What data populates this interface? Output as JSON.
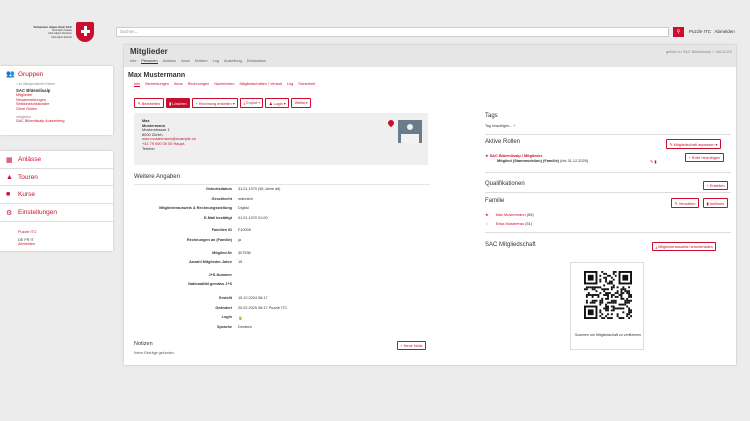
{
  "logo": {
    "lines": [
      "Schweizer Alpen-Club SAC",
      "Club Alpin Suisse",
      "Club Alpino Svizzero",
      "Club Alpin Svizzer"
    ]
  },
  "sidebar": {
    "groups_label": "Gruppen",
    "parent_link": "< zu übergeordneter Ebene",
    "section_title": "SAC Blüemlisalp",
    "section_items": [
      "Mitglieder",
      "Neuanmeldungen",
      "Sektionsfunktionäre",
      "Ohne Rollen"
    ],
    "sub_title": "zeitgleiche",
    "sub_item": "SAC Blüemlisalp Ausserberg",
    "nav": [
      {
        "label": "Anlässe",
        "icon": "calendar-icon"
      },
      {
        "label": "Touren",
        "icon": "mountain-icon"
      },
      {
        "label": "Kurse",
        "icon": "book-icon"
      },
      {
        "label": "Einstellungen",
        "icon": "cog-icon"
      }
    ],
    "footer_user": "Puzzle ITC",
    "footer_langs": "DE FR IT",
    "footer_logout": "Abmelden"
  },
  "topbar": {
    "search_placeholder": "Suchen...",
    "user": "Puzzle ITC",
    "logout": "Abmelden"
  },
  "page": {
    "title": "Mitglieder",
    "crumb": "gehört zu SAC Blüemlisalp > SAC/CAS",
    "tabs": [
      "Info",
      "Personen",
      "Anlässe",
      "Abos",
      "Notizen",
      "Log",
      "Ausleitung",
      "Deklaration"
    ],
    "active_tab": 1
  },
  "person": {
    "name": "Max Mustermann",
    "tabs": [
      "Info",
      "Bemerkungen",
      "Abos",
      "Rechnungen",
      "Nachrichten",
      "Mitgliedschaften / Verlauf",
      "Log",
      "Sicherheit"
    ],
    "active_tab": 0,
    "buttons": {
      "edit": "Bearbeiten",
      "delete": "Löschen",
      "invoice": "Rechnung erstellen",
      "export": "Export",
      "login": "Login",
      "more": "Weitere"
    },
    "address": {
      "first": "Max",
      "last": "Mustermann",
      "street": "Musterstrasse 1",
      "city": "8000 Zürich",
      "email": "max.mustermann@example.ch",
      "phone_label": "+41 79 000 00 00 Haupt-",
      "phone_suffix": "Telefon"
    },
    "weitere_label": "Weitere Angaben",
    "details": [
      {
        "k": "Geburtsdatum",
        "v": "31.01.1970 (55 Jahre alt)"
      },
      {
        "k": "Geschlecht",
        "v": "männlich"
      },
      {
        "k": "Mitgliederausweis & Rechnungsstellung",
        "v": "Digital"
      },
      {
        "k": "E-Mail bestätigt",
        "v": "01.01.1970 01:00"
      },
      {
        "k": "Familien ID",
        "v": "F10005"
      },
      {
        "k": "Rechnungen an (Familie)",
        "v": "ja"
      },
      {
        "k": "Mitglied-Nr",
        "v": "307536"
      },
      {
        "k": "Anzahl Mitglieder-Jahre",
        "v": "15"
      },
      {
        "k": "J+S-Nummer",
        "v": ""
      },
      {
        "k": "Nationalität gemäss J+S",
        "v": ""
      },
      {
        "k": "Erstellt",
        "v": "15.12.2024 08:17"
      },
      {
        "k": "Geändert",
        "v": "20.02.2025 08:17 Puzzle ITC"
      },
      {
        "k": "Login",
        "v": "🔒"
      },
      {
        "k": "Sprache",
        "v": "Deutsch"
      }
    ],
    "notes_label": "Notizen",
    "notes_empty": "Keine Einträge gefunden.",
    "new_note": "Neue Notiz"
  },
  "right": {
    "tags_label": "Tags",
    "tags_add": "Tag hinzufügen...",
    "roles_label": "Aktive Rollen",
    "roles_button": "Mitgliedschaft anpassen",
    "role_group": "SAC Blüemlisalp / Mitglieder",
    "role_detail": "Mitglied (Stammsektion) (Familie)",
    "role_since": "(bis 31.12.2025)",
    "add_role": "Rolle hinzufügen",
    "qual_label": "Qualifikationen",
    "qual_button": "Erstellen",
    "family_label": "Familie",
    "family_manage": "Verwalten",
    "family_leave": "Auflösen",
    "family_members": [
      {
        "name": "Max Mustermann",
        "age": "(55)"
      },
      {
        "name": "Erika Musterfrau",
        "age": "(51)"
      }
    ],
    "membership_label": "SAC Mitgliedschaft",
    "membership_button": "Mitgliederausweis herunterladen",
    "qr_caption": "Scannen um Mitgliedschaft zu verifizieren"
  },
  "colors": {
    "accent": "#c8102e"
  }
}
